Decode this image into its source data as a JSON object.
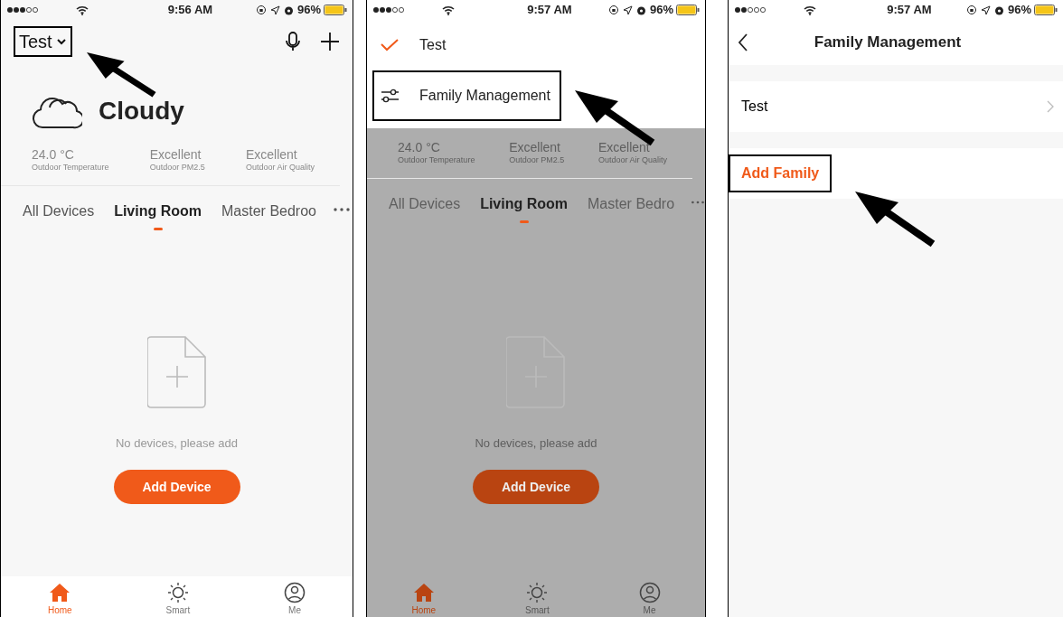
{
  "screens": [
    {
      "kind": "home",
      "status_bar": {
        "time": "9:56 AM",
        "battery": "96%"
      },
      "home_selector": {
        "label": "Test",
        "highlighted": true
      },
      "weather": {
        "condition": "Cloudy"
      },
      "stats": [
        {
          "value": "24.0 °C",
          "label": "Outdoor Temperature"
        },
        {
          "value": "Excellent",
          "label": "Outdoor PM2.5"
        },
        {
          "value": "Excellent",
          "label": "Outdoor Air Quality"
        }
      ],
      "rooms": [
        {
          "label": "All Devices",
          "selected": false
        },
        {
          "label": "Living Room",
          "selected": true
        },
        {
          "label": "Master Bedroo",
          "selected": false
        }
      ],
      "empty": {
        "message": "No devices, please add",
        "button": "Add Device"
      },
      "tab_bar": [
        {
          "label": "Home",
          "selected": true
        },
        {
          "label": "Smart",
          "selected": false
        },
        {
          "label": "Me",
          "selected": false
        }
      ]
    },
    {
      "kind": "home_menu",
      "status_bar": {
        "time": "9:57 AM",
        "battery": "96%"
      },
      "menu": [
        {
          "kind": "family",
          "label": "Test",
          "checked": true,
          "highlighted": false
        },
        {
          "kind": "manage",
          "label": "Family Management",
          "highlighted": true
        }
      ],
      "stats": [
        {
          "value": "24.0 °C",
          "label": "Outdoor Temperature"
        },
        {
          "value": "Excellent",
          "label": "Outdoor PM2.5"
        },
        {
          "value": "Excellent",
          "label": "Outdoor Air Quality"
        }
      ],
      "rooms": [
        {
          "label": "All Devices",
          "selected": false
        },
        {
          "label": "Living Room",
          "selected": true
        },
        {
          "label": "Master Bedro",
          "selected": false
        }
      ],
      "empty": {
        "message": "No devices, please add",
        "button": "Add Device"
      },
      "tab_bar": [
        {
          "label": "Home",
          "selected": true
        },
        {
          "label": "Smart",
          "selected": false
        },
        {
          "label": "Me",
          "selected": false
        }
      ]
    },
    {
      "kind": "family_management",
      "status_bar": {
        "time": "9:57 AM",
        "battery": "96%"
      },
      "title": "Family Management",
      "families": [
        {
          "label": "Test"
        }
      ],
      "add_button": {
        "label": "Add Family",
        "highlighted": true
      }
    }
  ]
}
